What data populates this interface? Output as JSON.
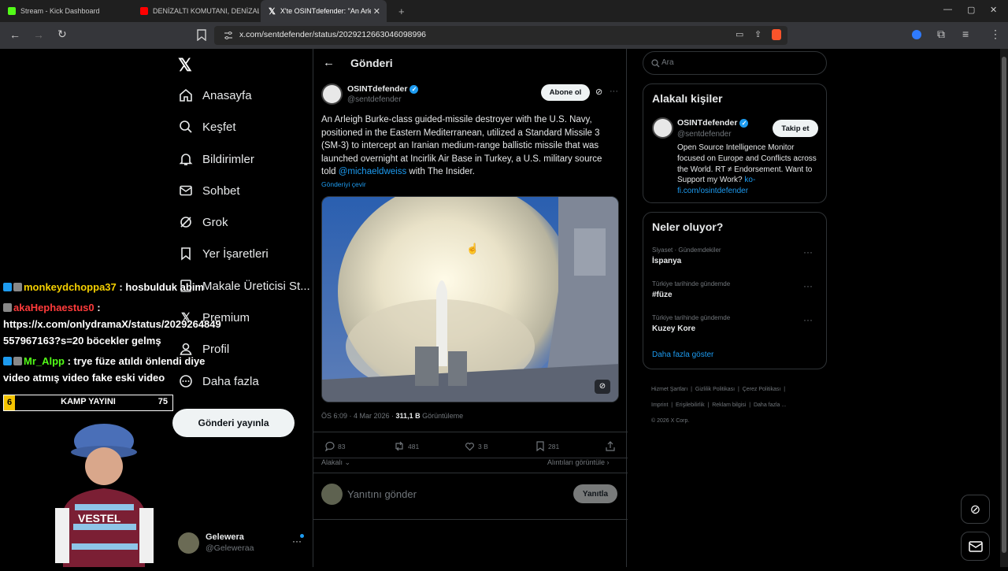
{
  "browser": {
    "tabs": [
      {
        "label": "Stream - Kick Dashboard",
        "color": "#53fc18"
      },
      {
        "label": "DENİZALTI KOMUTANI, DENİZALTI SA",
        "color": "#ff0000"
      },
      {
        "label": "X'te OSINTdefender: \"An Arlei",
        "color": "#ffffff"
      }
    ],
    "new_tab": "+",
    "url": "x.com/sentdefender/status/2029212663046098996",
    "win_min": "—",
    "win_max": "▢",
    "win_close": "✕"
  },
  "sidebar": {
    "items": [
      {
        "label": "Anasayfa",
        "icon": "home-icon"
      },
      {
        "label": "Keşfet",
        "icon": "search-icon"
      },
      {
        "label": "Bildirimler",
        "icon": "bell-icon"
      },
      {
        "label": "Sohbet",
        "icon": "mail-icon"
      },
      {
        "label": "Grok",
        "icon": "grok-icon"
      },
      {
        "label": "Yer İşaretleri",
        "icon": "bookmark-icon"
      },
      {
        "label": "Makale Üreticisi St...",
        "icon": "article-icon"
      },
      {
        "label": "Premium",
        "icon": "x-icon"
      },
      {
        "label": "Profil",
        "icon": "person-icon"
      },
      {
        "label": "Daha fazla",
        "icon": "more-icon"
      }
    ],
    "post_button": "Gönderi yayınla",
    "account": {
      "name": "Gelewera",
      "handle": "@Geleweraa",
      "more": "···"
    }
  },
  "post": {
    "header_title": "Gönderi",
    "author": "OSINTdefender",
    "handle": "@sentdefender",
    "subscribe": "Abone ol",
    "more": "···",
    "text_before": "An Arleigh Burke-class guided-missile destroyer with the U.S. Navy, positioned in the Eastern Mediterranean, utilized a Standard Missile 3 (SM-3) to intercept an Iranian medium-range ballistic missile that was launched overnight at Incirlik Air Base in Turkey, a U.S. military source told ",
    "mention": "@michaeldweiss",
    "text_after": " with The Insider.",
    "translate": "Gönderiyi çevir",
    "time": "ÖS 6:09 · 4 Mar 2026 · ",
    "views": "311,1 B",
    "views_label": " Görüntüleme",
    "replies": "83",
    "reposts": "481",
    "likes": "3 B",
    "bookmarks": "281",
    "relevant": "Alakalı",
    "quotes": "Alıntıları görüntüle",
    "reply_placeholder": "Yanıtını gönder",
    "reply_button": "Yanıtla"
  },
  "right": {
    "search_placeholder": "Ara",
    "people_title": "Alakalı kişiler",
    "person": {
      "name": "OSINTdefender",
      "handle": "@sentdefender",
      "follow": "Takip et",
      "bio": "Open Source Intelligence Monitor focused on Europe and Conflicts across the World. RT ≠ Endorsement. Want to Support my Work? ",
      "link": "ko-fi.com/osintdefender"
    },
    "trends_title": "Neler oluyor?",
    "trends": [
      {
        "category": "Siyaset · Gündemdekiler",
        "name": "İspanya"
      },
      {
        "category": "Türkiye tarihinde gündemde",
        "name": "#füze"
      },
      {
        "category": "Türkiye tarihinde gündemde",
        "name": "Kuzey Kore"
      }
    ],
    "show_more": "Daha fazla göster",
    "footer": [
      "Hizmet Şartları",
      "Gizlilik Politikası",
      "Çerez Politikası",
      "Imprint",
      "Erişilebilirlik",
      "Reklam bilgisi",
      "Daha fazla ...",
      "© 2026 X Corp."
    ]
  },
  "stream": {
    "chat": [
      {
        "user": "monkeydchoppa37",
        "color": "#f5d000",
        "message": " : hosbulduk abim"
      },
      {
        "user": "akaHephaestus0",
        "color": "#ff3b3b",
        "message": " :"
      },
      {
        "user": "",
        "color": "#ffffff",
        "message": "https://x.com/onlydramaX/status/2029264849"
      },
      {
        "user": "",
        "color": "#ffffff",
        "message": "557967163?s=20 böcekler gelmş"
      },
      {
        "user": "Mr_Alpp",
        "color": "#53fc18",
        "message": " : trye füze atıldı önlendi diye"
      },
      {
        "user": "",
        "color": "#ffffff",
        "message": "video atmış video fake eski video"
      }
    ],
    "camp_left": "6",
    "camp_label": "KAMP YAYINI",
    "camp_right": "75",
    "jersey_text": "VESTEL"
  }
}
